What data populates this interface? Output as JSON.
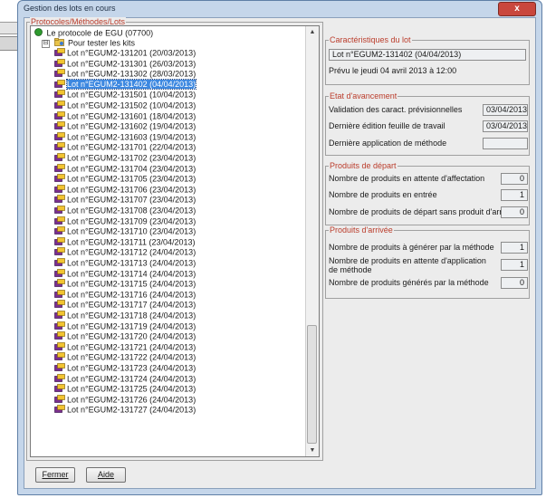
{
  "window": {
    "title": "Gestion des lots en cours",
    "close_symbol": "x"
  },
  "tree_panel": {
    "title": "Protocoles/Méthodes/Lots",
    "root": {
      "label": "Le protocole de EGU (07700)",
      "icon": "green-circle-icon",
      "expander": "−"
    },
    "method": {
      "label": "Pour tester les kits",
      "icon": "folder-icon",
      "expander": "⊟"
    },
    "lots": [
      "Lot n°EGUM2-131201 (20/03/2013)",
      "Lot n°EGUM2-131301 (26/03/2013)",
      "Lot n°EGUM2-131302 (28/03/2013)",
      "Lot n°EGUM2-131402 (04/04/2013)",
      "Lot n°EGUM2-131501 (10/04/2013)",
      "Lot n°EGUM2-131502 (10/04/2013)",
      "Lot n°EGUM2-131601 (18/04/2013)",
      "Lot n°EGUM2-131602 (19/04/2013)",
      "Lot n°EGUM2-131603 (19/04/2013)",
      "Lot n°EGUM2-131701 (22/04/2013)",
      "Lot n°EGUM2-131702 (23/04/2013)",
      "Lot n°EGUM2-131704 (23/04/2013)",
      "Lot n°EGUM2-131705 (23/04/2013)",
      "Lot n°EGUM2-131706 (23/04/2013)",
      "Lot n°EGUM2-131707 (23/04/2013)",
      "Lot n°EGUM2-131708 (23/04/2013)",
      "Lot n°EGUM2-131709 (23/04/2013)",
      "Lot n°EGUM2-131710 (23/04/2013)",
      "Lot n°EGUM2-131711 (23/04/2013)",
      "Lot n°EGUM2-131712 (24/04/2013)",
      "Lot n°EGUM2-131713 (24/04/2013)",
      "Lot n°EGUM2-131714 (24/04/2013)",
      "Lot n°EGUM2-131715 (24/04/2013)",
      "Lot n°EGUM2-131716 (24/04/2013)",
      "Lot n°EGUM2-131717 (24/04/2013)",
      "Lot n°EGUM2-131718 (24/04/2013)",
      "Lot n°EGUM2-131719 (24/04/2013)",
      "Lot n°EGUM2-131720 (24/04/2013)",
      "Lot n°EGUM2-131721 (24/04/2013)",
      "Lot n°EGUM2-131722 (24/04/2013)",
      "Lot n°EGUM2-131723 (24/04/2013)",
      "Lot n°EGUM2-131724 (24/04/2013)",
      "Lot n°EGUM2-131725 (24/04/2013)",
      "Lot n°EGUM2-131726 (24/04/2013)",
      "Lot n°EGUM2-131727 (24/04/2013)"
    ],
    "selected_lot": "Lot n°EGUM2-131402 (04/04/2013)",
    "lot_icon": "lot-box-icon",
    "scroll_up_symbol": "▲",
    "scroll_down_symbol": "▼"
  },
  "characteristics": {
    "title": "Caractéristiques du lot",
    "lot_name": "Lot n°EGUM2-131402 (04/04/2013)",
    "planned": "Prévu le jeudi 04 avril 2013 à 12:00"
  },
  "progress": {
    "title": "Etat d'avancement",
    "validation_label": "Validation des caract. prévisionnelles",
    "validation_value": "03/04/2013",
    "last_sheet_label": "Dernière édition feuille de travail",
    "last_sheet_value": "03/04/2013",
    "last_method_label": "Dernière application de méthode",
    "last_method_value": ""
  },
  "start_products": {
    "title": "Produits de départ",
    "waiting_label": "Nombre de produits en attente d'affectation",
    "waiting_value": "0",
    "input_label": "Nombre de produits en entrée",
    "input_value": "1",
    "no_arrival_label": "Nombre de produits de départ sans produit d'arrivée",
    "no_arrival_value": "0"
  },
  "arrival_products": {
    "title": "Produits d'arrivée",
    "to_generate_label": "Nombre de produits à générer par la méthode",
    "to_generate_value": "1",
    "waiting_method_label": "Nombre de produits en attente d'application de méthode",
    "waiting_method_value": "1",
    "generated_label": "Nombre de produits générés par la méthode",
    "generated_value": "0"
  },
  "buttons": {
    "close_label": "Fermer",
    "help_label": "Aide"
  },
  "colors": {
    "accent_title": "#bb3d2c",
    "selection": "#3d88e0",
    "frame": "#c5d6ea"
  }
}
